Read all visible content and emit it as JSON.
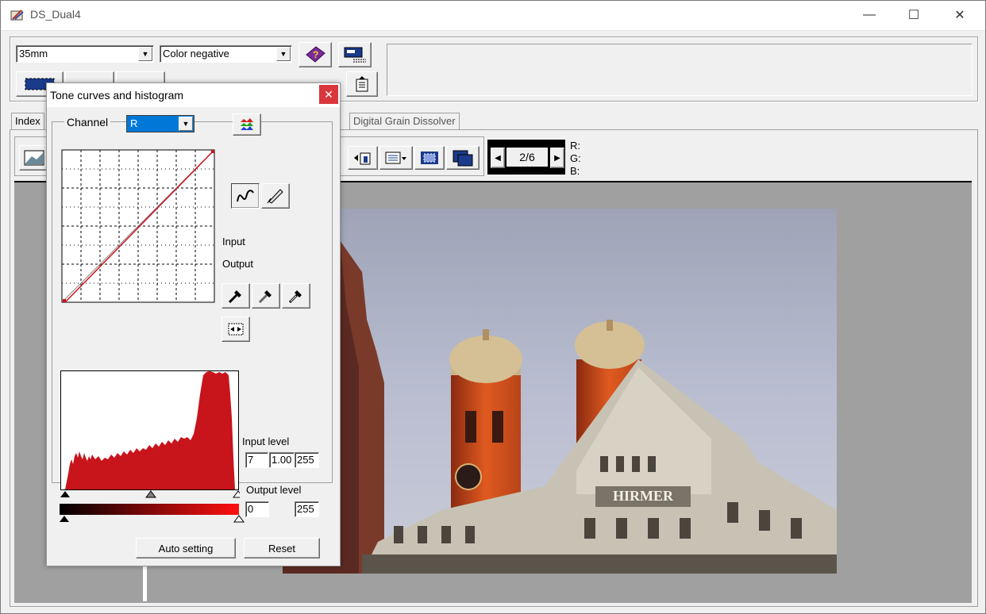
{
  "window": {
    "title": "DS_Dual4"
  },
  "toolbar": {
    "film_size": "35mm",
    "film_type": "Color negative"
  },
  "tabs": {
    "index": "Index",
    "grain": "Digital Grain Dissolver"
  },
  "preview": {
    "frame_counter": "2/6",
    "r_label": "R:",
    "g_label": "G:",
    "b_label": "B:",
    "sign_text": "HIRMER"
  },
  "dialog": {
    "title": "Tone curves and histogram",
    "channel_label": "Channel",
    "channel_value": "R",
    "input_label": "Input",
    "output_label": "Output",
    "input_level_label": "Input level",
    "input_level_low": "7",
    "input_level_gamma": "1.00",
    "input_level_high": "255",
    "output_level_label": "Output level",
    "output_level_low": "0",
    "output_level_high": "255",
    "auto_setting": "Auto setting",
    "reset": "Reset",
    "accent": "#c8141b"
  }
}
